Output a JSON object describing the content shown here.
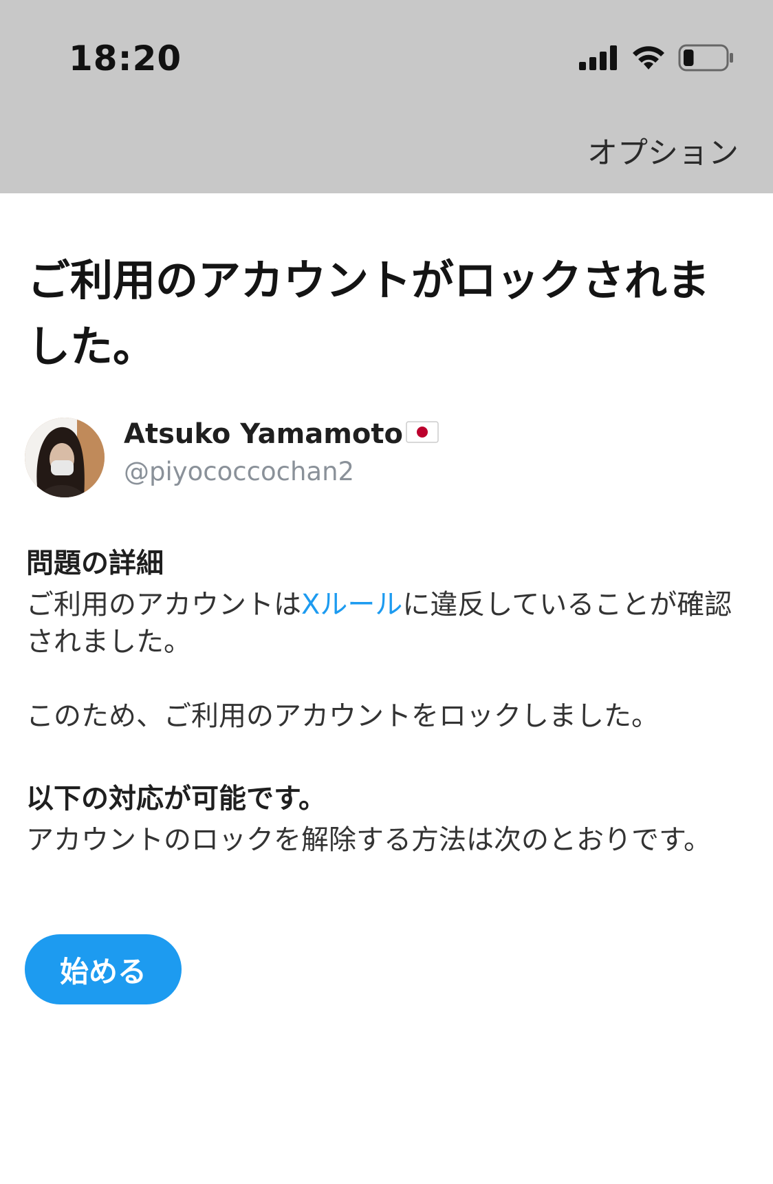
{
  "status_bar": {
    "time": "18:20",
    "signal_icon": "cellular-signal-icon",
    "wifi_icon": "wifi-icon",
    "battery_icon": "battery-icon",
    "battery_level": 0.25
  },
  "header": {
    "options_label": "オプション"
  },
  "title": "ご利用のアカウントがロックされました。",
  "user": {
    "name": "Atsuko Yamamoto",
    "flag_icon": "japan-flag-icon",
    "handle": "@piyococcochan2",
    "avatar_icon": "user-avatar"
  },
  "details": {
    "heading": "問題の詳細",
    "paragraph1_before": "ご利用のアカウントは",
    "paragraph1_link": "Xルール",
    "paragraph1_after": "に違反していることが確認されました。",
    "paragraph2": "このため、ご利用のアカウントをロックしました。"
  },
  "next_steps": {
    "heading": "以下の対応が可能です。",
    "text": "アカウントのロックを解除する方法は次のとおりです。"
  },
  "start_button": "始める",
  "colors": {
    "accent": "#1d9bf0",
    "header_bg": "#c8c8c8",
    "handle_gray": "#8a9199"
  }
}
